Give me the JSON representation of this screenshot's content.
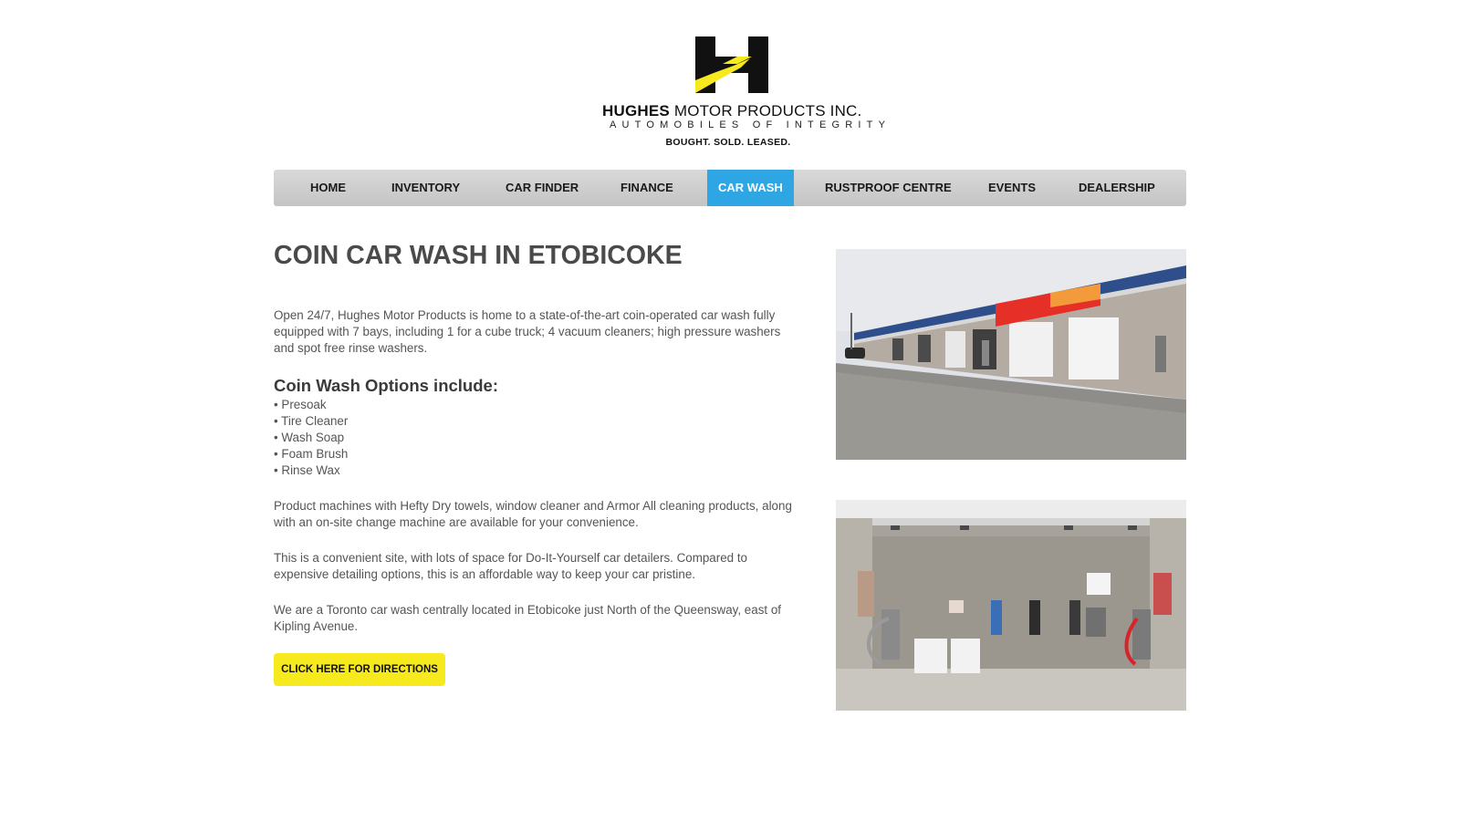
{
  "logo": {
    "name_bold": "HUGHES",
    "name_rest": " MOTOR PRODUCTS INC.",
    "tagline": "AUTOMOBILES OF INTEGRITY",
    "subline": "BOUGHT. SOLD. LEASED.",
    "colors": {
      "black": "#111111",
      "yellow": "#f6ea1f"
    }
  },
  "nav": {
    "items": [
      {
        "label": "HOME"
      },
      {
        "label": "INVENTORY"
      },
      {
        "label": "CAR FINDER"
      },
      {
        "label": "FINANCE"
      },
      {
        "label": "CAR WASH",
        "active": true
      },
      {
        "label": "RUSTPROOF CENTRE"
      },
      {
        "label": "EVENTS"
      },
      {
        "label": "DEALERSHIP"
      }
    ],
    "active_color": "#2fa6e4"
  },
  "content": {
    "title": "COIN CAR WASH IN ETOBICOKE",
    "intro": "Open 24/7, Hughes Motor Products is home to a state-of-the-art coin-operated car wash fully equipped with 7 bays, including 1 for a cube truck; 4 vacuum cleaners; high pressure washers and spot free rinse washers.",
    "options_heading": "Coin Wash Options include:",
    "options": [
      "• Presoak",
      "• Tire Cleaner",
      "• Wash Soap",
      "• Foam Brush",
      "• Rinse Wax"
    ],
    "para2": "Product machines with Hefty Dry towels, window cleaner and Armor All cleaning products, along with an on-site change machine are available for your convenience.",
    "para3": "This is a convenient site, with lots of space for Do-It-Yourself car detailers. Compared to expensive detailing options, this is an affordable way to keep your car pristine.",
    "para4": "We are a Toronto car wash centrally located in Etobicoke just North of the Queensway, east of Kipling Avenue.",
    "button_label": "CLICK HERE FOR DIRECTIONS",
    "button_color": "#f6ea1f"
  }
}
